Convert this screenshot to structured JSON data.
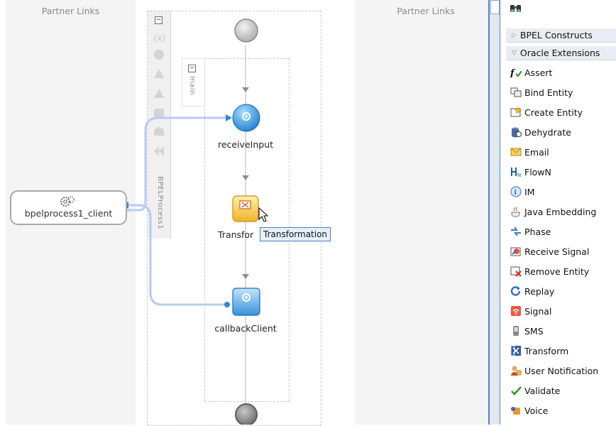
{
  "left_lane": {
    "title": "Partner Links"
  },
  "right_lane": {
    "title": "Partner Links"
  },
  "scope": {
    "process_name": "BPELProcess1",
    "sequence_name": "main"
  },
  "client": {
    "label": "bpelprocess1_client"
  },
  "activities": {
    "receive": {
      "label": "receiveInput"
    },
    "transform": {
      "label": "Transfor"
    },
    "callback": {
      "label": "callbackClient"
    }
  },
  "tooltip": {
    "text": "Transformation"
  },
  "palette": {
    "sections": [
      {
        "label": "BPEL Constructs",
        "expanded": false
      },
      {
        "label": "Oracle Extensions",
        "expanded": true
      }
    ],
    "items": [
      {
        "label": "Assert",
        "icon": "assert-icon"
      },
      {
        "label": "Bind Entity",
        "icon": "bind-entity-icon"
      },
      {
        "label": "Create Entity",
        "icon": "create-entity-icon"
      },
      {
        "label": "Dehydrate",
        "icon": "dehydrate-icon"
      },
      {
        "label": "Email",
        "icon": "email-icon"
      },
      {
        "label": "FlowN",
        "icon": "flown-icon"
      },
      {
        "label": "IM",
        "icon": "im-icon"
      },
      {
        "label": "Java Embedding",
        "icon": "java-embedding-icon"
      },
      {
        "label": "Phase",
        "icon": "phase-icon"
      },
      {
        "label": "Receive Signal",
        "icon": "receive-signal-icon"
      },
      {
        "label": "Remove Entity",
        "icon": "remove-entity-icon"
      },
      {
        "label": "Replay",
        "icon": "replay-icon"
      },
      {
        "label": "Signal",
        "icon": "signal-icon"
      },
      {
        "label": "SMS",
        "icon": "sms-icon"
      },
      {
        "label": "Transform",
        "icon": "transform-icon"
      },
      {
        "label": "User Notification",
        "icon": "user-notification-icon"
      },
      {
        "label": "Validate",
        "icon": "validate-icon"
      },
      {
        "label": "Voice",
        "icon": "voice-icon"
      }
    ]
  },
  "colors": {
    "accent": "#2e87d6",
    "wire": "#b9c9f2",
    "palette_border": "#4a86d0"
  }
}
